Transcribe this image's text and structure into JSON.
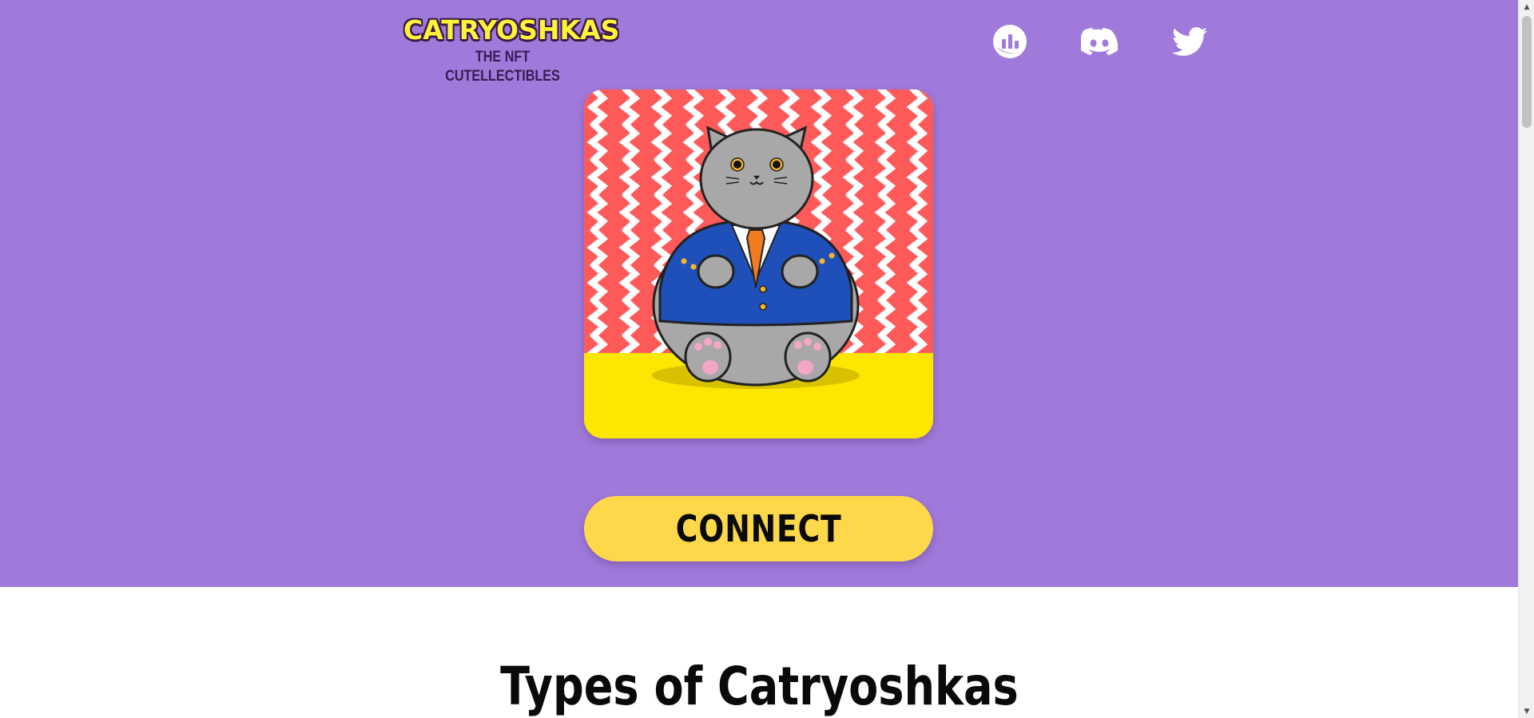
{
  "header": {
    "logo_text": "CATRYOSHKAS",
    "logo_tagline": "THE NFT CUTELLECTIBLES",
    "social": [
      {
        "name": "market-stats",
        "icon": "chart-icon"
      },
      {
        "name": "discord",
        "icon": "discord-icon"
      },
      {
        "name": "twitter",
        "icon": "twitter-icon"
      }
    ]
  },
  "hero": {
    "background_color": "#a07adb",
    "artwork_alt": "cat in blue suit",
    "connect_label": "CONNECT",
    "connect_color": "#fdd84a"
  },
  "section": {
    "title": "Types of Catryoshkas"
  },
  "scrollbar": {
    "up": "▲",
    "down": "▼"
  }
}
